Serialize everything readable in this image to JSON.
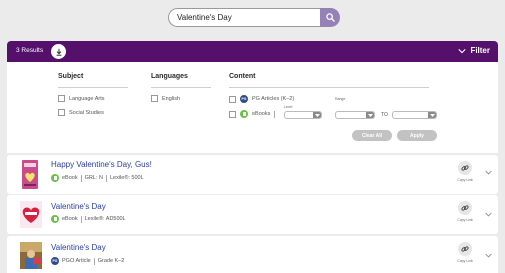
{
  "search": {
    "value": "Valentine's Day",
    "placeholder": ""
  },
  "toolbar": {
    "results_label": "3 Results",
    "filter_label": "Filter"
  },
  "filters": {
    "subject": {
      "heading": "Subject",
      "options": [
        "Language Arts",
        "Social Studies"
      ]
    },
    "languages": {
      "heading": "Languages",
      "options": [
        "English"
      ]
    },
    "content": {
      "heading": "Content",
      "options": [
        "PG Articles (K–2)",
        "eBooks"
      ],
      "level_label": "Level",
      "range_label": "Range",
      "to_label": "TO"
    },
    "clear_label": "Clear All",
    "apply_label": "Apply"
  },
  "results": [
    {
      "title": "Happy Valentine's Day, Gus!",
      "type": "eBook",
      "meta": [
        "GRL: N",
        "Lexile®: 500L"
      ],
      "copy_label": "Copy Link"
    },
    {
      "title": "Valentine's Day",
      "type": "eBook",
      "meta": [
        "Lexile®: AD500L"
      ],
      "copy_label": "Copy Link"
    },
    {
      "title": "Valentine's Day",
      "type": "PGO Article",
      "meta": [
        "Grade K–2"
      ],
      "copy_label": "Copy Link"
    }
  ],
  "colors": {
    "header_bar": "#54106b",
    "title_link": "#2c3f9e",
    "ebook_badge": "#6cc04a",
    "article_badge": "#2f4b8a",
    "search_button": "#9580b8"
  },
  "icons": {
    "search": "search-icon",
    "download": "download-icon",
    "filter_toggle": "chevron-down-icon",
    "copy": "link-icon",
    "expand": "chevron-down-icon"
  }
}
